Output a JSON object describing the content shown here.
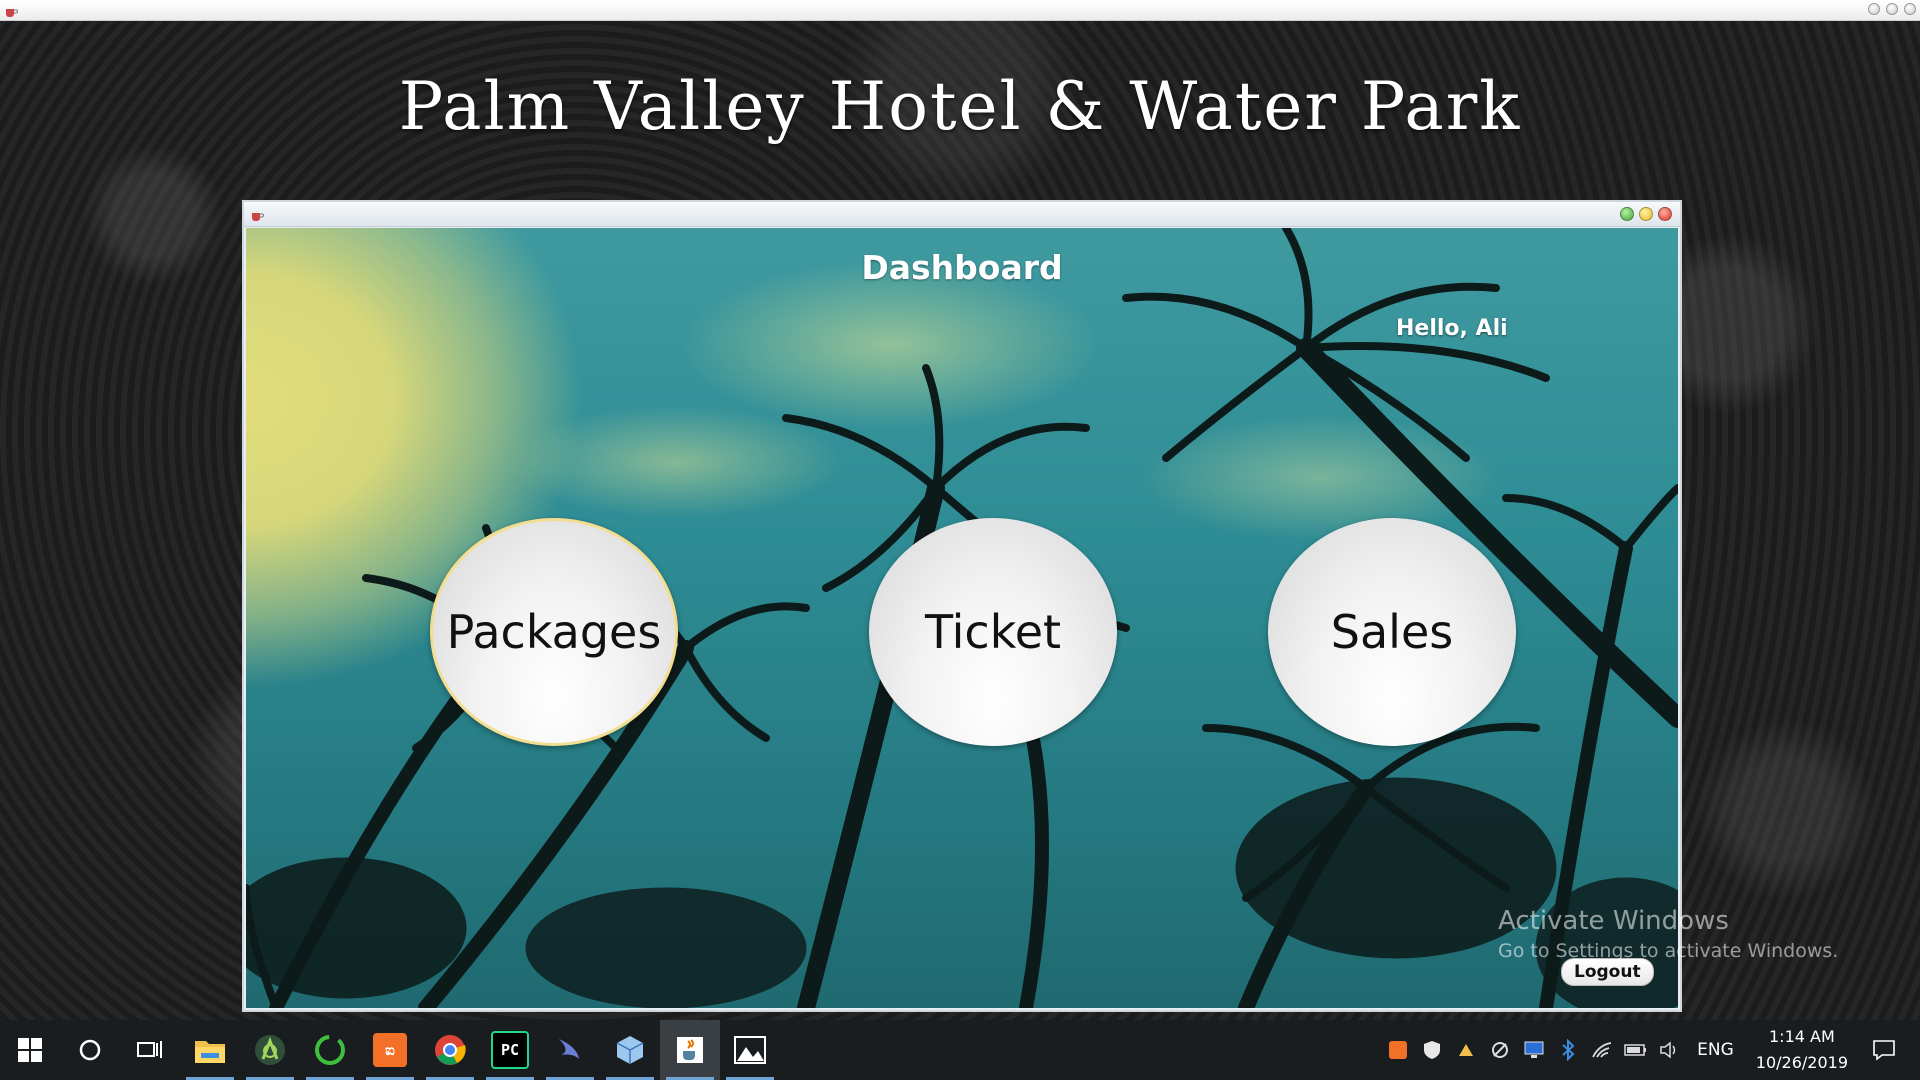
{
  "app": {
    "title": "Palm Valley Hotel & Water Park"
  },
  "dashboard": {
    "title": "Dashboard",
    "greeting": "Hello, Ali",
    "buttons": {
      "packages": "Packages",
      "ticket": "Ticket",
      "sales": "Sales"
    },
    "logout_label": "Logout"
  },
  "watermark": {
    "line1": "Activate Windows",
    "line2": "Go to Settings to activate Windows."
  },
  "taskbar": {
    "apps": [
      {
        "name": "file-explorer-icon"
      },
      {
        "name": "android-studio-icon"
      },
      {
        "name": "app-ring-icon"
      },
      {
        "name": "xampp-icon",
        "label": "ಐ"
      },
      {
        "name": "chrome-icon"
      },
      {
        "name": "pycharm-icon",
        "label": "PC"
      },
      {
        "name": "swift-icon"
      },
      {
        "name": "virtualbox-icon"
      },
      {
        "name": "java-icon"
      },
      {
        "name": "photos-icon"
      }
    ],
    "tray": {
      "language": "ENG",
      "time": "1:14 AM",
      "date": "10/26/2019"
    }
  },
  "colors": {
    "accent": "#6fa3d6",
    "packages_border": "#f3dd8e",
    "close_dot": "#d8332a",
    "minimize_dot": "#e6b82a",
    "maximize_dot": "#3ea53a"
  }
}
